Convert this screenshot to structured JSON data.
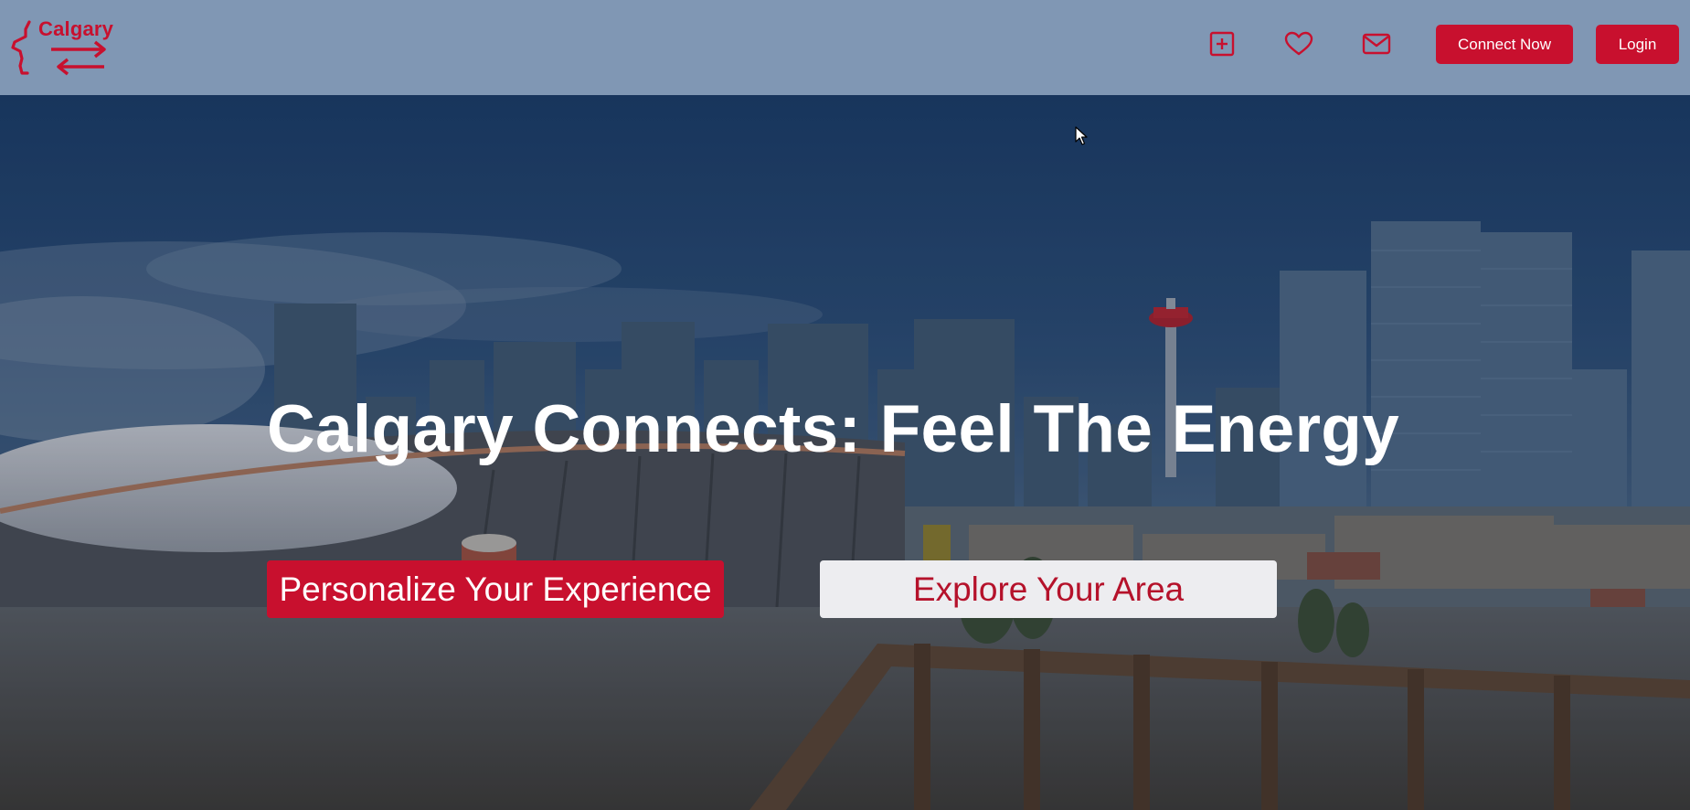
{
  "header": {
    "logo_text": "Calgary",
    "icons": {
      "add": "plus-square-icon",
      "favorites": "heart-icon",
      "messages": "envelope-icon"
    },
    "connect_label": "Connect Now",
    "login_label": "Login"
  },
  "hero": {
    "title": "Calgary Connects: Feel The Energy",
    "primary_button": "Personalize Your Experience",
    "secondary_button": "Explore Your Area"
  },
  "colors": {
    "brand_red": "#c8102e",
    "header_bg": "#8097b4",
    "secondary_button_bg": "#ededf0"
  }
}
